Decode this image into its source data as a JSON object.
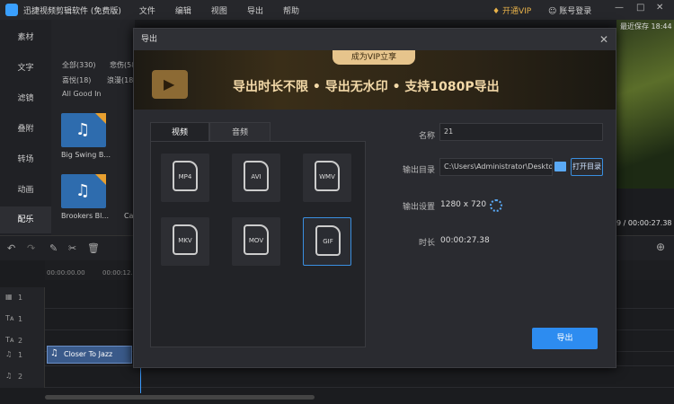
{
  "app": {
    "title": "迅捷视频剪辑软件 (免费版)",
    "menu": [
      "文件",
      "编辑",
      "视图",
      "导出",
      "帮助"
    ],
    "vip_label": "开通VIP",
    "login_label": "账号登录",
    "autosave": "最近保存 18:44"
  },
  "sidebar": {
    "items": [
      {
        "label": "素材"
      },
      {
        "label": "文字"
      },
      {
        "label": "滤镜"
      },
      {
        "label": "叠附"
      },
      {
        "label": "转场"
      },
      {
        "label": "动画"
      },
      {
        "label": "配乐",
        "active": true
      }
    ]
  },
  "library": {
    "filters": [
      "全部(330)",
      "悲伤(58",
      "喜悦(18)",
      "浪漫(18",
      "All Good In"
    ],
    "items": [
      {
        "label": "Big Swing B..."
      },
      {
        "label": "Brookers Bl..."
      }
    ],
    "peek_label": "Ca"
  },
  "preview": {
    "timecode": "9 / 00:00:27.38"
  },
  "timeline": {
    "ruler_start": "00:00:00.00",
    "ruler_mark": "00:00:12.",
    "tracks": [
      "1",
      "1",
      "2",
      "1",
      "2"
    ],
    "clip_label": "Closer To Jazz"
  },
  "dialog": {
    "title": "导出",
    "banner_tag": "成为VIP立享",
    "banner_text": "导出时长不限 • 导出无水印 • 支持1080P导出",
    "tabs": [
      "视频",
      "音频"
    ],
    "formats": [
      "MP4",
      "AVI",
      "WMV",
      "MKV",
      "MOV",
      "GIF"
    ],
    "selected_format": "GIF",
    "name_label": "名称",
    "name_value": "21",
    "dir_label": "输出目录",
    "dir_value": "C:\\Users\\Administrator\\Desktop\\",
    "open_dir_label": "打开目录",
    "settings_label": "输出设置",
    "settings_value": "1280 x 720",
    "duration_label": "时长",
    "duration_value": "00:00:27.38",
    "export_label": "导出"
  },
  "colors": {
    "accent": "#2d8cf0",
    "vip": "#e8b24a"
  }
}
